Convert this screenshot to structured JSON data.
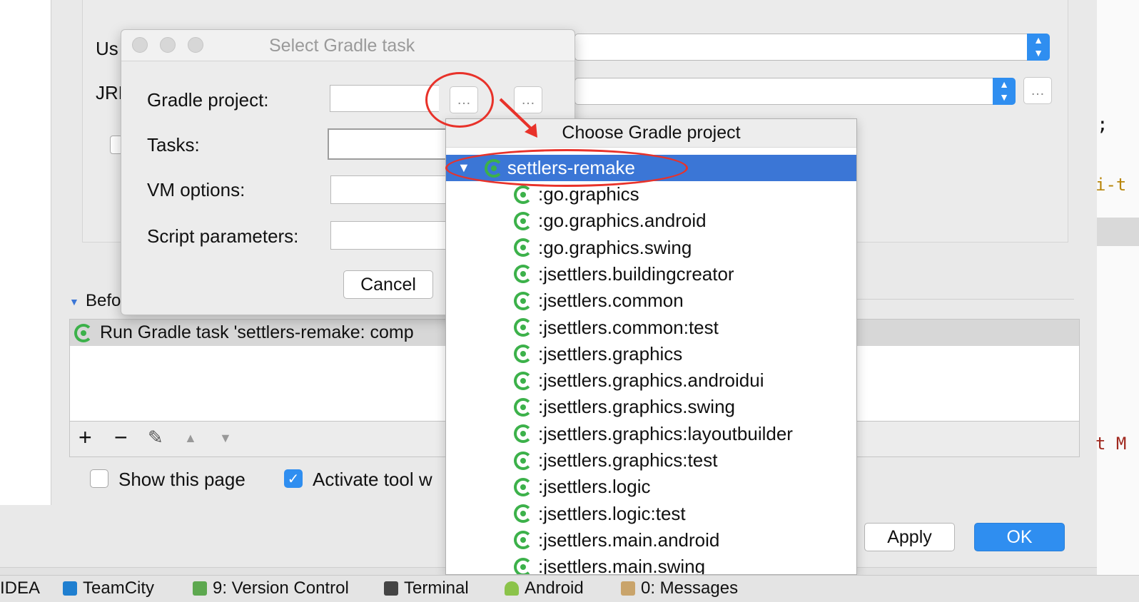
{
  "background": {
    "use_label": "Us",
    "jre_label": "JRE",
    "before_launch_label": "Befo",
    "task_row_text": "Run Gradle task 'settlers-remake: comp",
    "show_page_label": "Show this page",
    "activate_tool_label": "Activate tool w",
    "apply_label": "Apply",
    "ok_label": "OK",
    "dots_label": "…",
    "right_edge": {
      "semicolon": ";",
      "snippet1": "i-t",
      "snippet2": "t M"
    }
  },
  "toolbar_icons": {
    "add": "+",
    "remove": "−",
    "edit": "✎",
    "up": "▲",
    "down": "▼"
  },
  "dialog": {
    "title": "Select Gradle task",
    "gradle_project_label": "Gradle project:",
    "tasks_label": "Tasks:",
    "vm_options_label": "VM options:",
    "script_params_label": "Script parameters:",
    "cancel_label": "Cancel",
    "dots_label": "…"
  },
  "popup": {
    "title": "Choose Gradle project",
    "root": "settlers-remake",
    "items": [
      ":go.graphics",
      ":go.graphics.android",
      ":go.graphics.swing",
      ":jsettlers.buildingcreator",
      ":jsettlers.common",
      ":jsettlers.common:test",
      ":jsettlers.graphics",
      ":jsettlers.graphics.androidui",
      ":jsettlers.graphics.swing",
      ":jsettlers.graphics:layoutbuilder",
      ":jsettlers.graphics:test",
      ":jsettlers.logic",
      ":jsettlers.logic:test",
      ":jsettlers.main.android",
      ":jsettlers.main.swing"
    ]
  },
  "statusbar": {
    "items": [
      "IDEA",
      "TeamCity",
      "9: Version Control",
      "Terminal",
      "Android",
      "0: Messages"
    ]
  },
  "colors": {
    "selection": "#3b76d6",
    "annotation": "#e8322a",
    "gradle_green": "#3cb14a",
    "ok_blue": "#2f8ef0"
  }
}
